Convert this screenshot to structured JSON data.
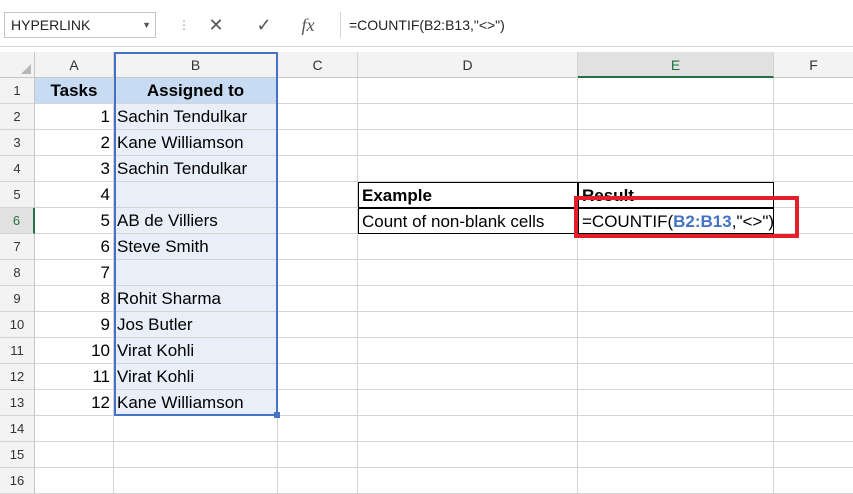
{
  "formula_bar": {
    "name_box": "HYPERLINK",
    "cancel_symbol": "✕",
    "enter_symbol": "✓",
    "fx_symbol": "fx",
    "formula": "=COUNTIF(B2:B13,\"<>\")"
  },
  "columns": [
    "A",
    "B",
    "C",
    "D",
    "E",
    "F"
  ],
  "rows": [
    "1",
    "2",
    "3",
    "4",
    "5",
    "6",
    "7",
    "8",
    "9",
    "10",
    "11",
    "12",
    "13",
    "14",
    "15",
    "16"
  ],
  "table": {
    "headers": [
      "Tasks",
      "Assigned to"
    ],
    "tasks": [
      "1",
      "2",
      "3",
      "4",
      "5",
      "6",
      "7",
      "8",
      "9",
      "10",
      "11",
      "12"
    ],
    "assigned": [
      "Sachin Tendulkar",
      "Kane Williamson",
      "Sachin Tendulkar",
      "",
      "AB de Villiers",
      "Steve Smith",
      "",
      "Rohit Sharma",
      "Jos Butler",
      "Virat Kohli",
      "Virat Kohli",
      "Kane Williamson"
    ]
  },
  "example_table": {
    "header_example": "Example",
    "header_result": "Result",
    "example": "Count of non-blank cells",
    "formula_prefix": "=COUNTIF(",
    "formula_ref": "B2:B13",
    "formula_suffix": ",\"<>\")"
  },
  "colors": {
    "header_fill": "#c7dcf2",
    "range_border": "#4472c4",
    "highlight_box": "#e3202a",
    "selected_header": "#217346"
  }
}
